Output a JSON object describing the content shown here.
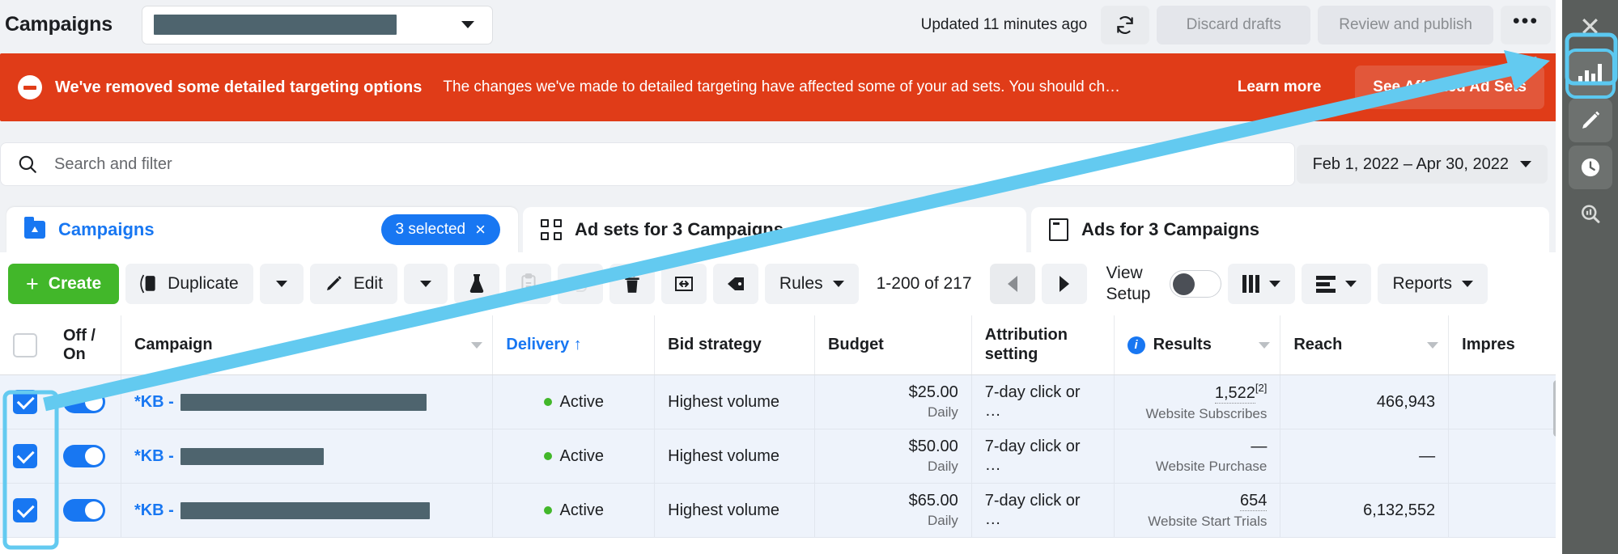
{
  "header": {
    "title": "Campaigns",
    "account_selector": {
      "value_redacted": true,
      "caret": "chevron-down-icon"
    },
    "updated_text": "Updated 11 minutes ago",
    "refresh_icon": "refresh-icon",
    "discard_label": "Discard drafts",
    "review_label": "Review and publish",
    "more_label": "•••"
  },
  "banner": {
    "icon": "minus-circle-icon",
    "title": "We've removed some detailed targeting options",
    "body": "The changes we've made to detailed targeting have affected some of your ad sets. You should ch…",
    "learn_more": "Learn more",
    "cta": "See Affected Ad Sets",
    "color": "#e03c18",
    "cta_color": "#e2573a"
  },
  "search": {
    "placeholder": "Search and filter",
    "icon": "search-icon",
    "date_range": "Feb 1, 2022 – Apr 30, 2022"
  },
  "tabs": [
    {
      "label": "Campaigns",
      "icon": "folder-icon",
      "active": true,
      "badge": "3 selected",
      "badge_close": "×"
    },
    {
      "label": "Ad sets for 3 Campaigns",
      "icon": "grid-icon",
      "active": false
    },
    {
      "label": "Ads for 3 Campaigns",
      "icon": "ads-icon",
      "active": false
    }
  ],
  "toolbar": {
    "create_label": "Create",
    "create_plus": "+",
    "duplicate_label": "Duplicate",
    "edit_label": "Edit",
    "ab_test_icon": "flask-icon",
    "clipboard_icon": "clipboard-icon",
    "undo_icon": "undo-icon",
    "delete_icon": "trash-icon",
    "export_icon": "export-icon",
    "tag_icon": "tag-icon",
    "rules_label": "Rules",
    "pagination": "1-200 of 217",
    "prev_icon": "triangle-left-icon",
    "next_icon": "triangle-right-icon",
    "view_setup_line1": "View",
    "view_setup_line2": "Setup",
    "toggle_state": "off",
    "columns_icon": "columns-icon",
    "breakdown_icon": "breakdown-icon",
    "reports_label": "Reports"
  },
  "table": {
    "columns": [
      {
        "key": "check",
        "label": "",
        "icon": "checkbox-icon"
      },
      {
        "key": "offon",
        "label": "Off / On"
      },
      {
        "key": "campaign",
        "label": "Campaign",
        "sortable": true
      },
      {
        "key": "delivery",
        "label": "Delivery ↑",
        "blue": true
      },
      {
        "key": "bid",
        "label": "Bid strategy"
      },
      {
        "key": "budget",
        "label": "Budget"
      },
      {
        "key": "attr",
        "label": "Attribution setting",
        "line1": "Attribution",
        "line2": "setting"
      },
      {
        "key": "results",
        "label": "Results",
        "info": true,
        "sortable": true
      },
      {
        "key": "reach",
        "label": "Reach",
        "sortable": true
      },
      {
        "key": "impr",
        "label": "Impres"
      }
    ],
    "rows": [
      {
        "checked": true,
        "toggle": "on",
        "campaign_prefix": "*KB -",
        "campaign_redact_width": 304,
        "delivery": "Active",
        "bid_strategy": "Highest volume",
        "budget": "$25.00",
        "budget_sub": "Daily",
        "attribution": "7-day click or …",
        "results_value": "1,522",
        "results_sup": "[2]",
        "results_sub": "Website Subscribes",
        "reach": "466,943"
      },
      {
        "checked": true,
        "toggle": "on",
        "campaign_prefix": "*KB -",
        "campaign_redact_width": 177,
        "delivery": "Active",
        "bid_strategy": "Highest volume",
        "budget": "$50.00",
        "budget_sub": "Daily",
        "attribution": "7-day click or …",
        "results_value": "—",
        "results_sup": "",
        "results_sub": "Website Purchase",
        "reach": "—"
      },
      {
        "checked": true,
        "toggle": "on",
        "campaign_prefix": "*KB -",
        "campaign_redact_width": 308,
        "delivery": "Active",
        "bid_strategy": "Highest volume",
        "budget": "$65.00",
        "budget_sub": "Daily",
        "attribution": "7-day click or …",
        "results_value": "654",
        "results_sup": "",
        "results_sub": "Website Start Trials",
        "reach": "6,132,552"
      }
    ]
  },
  "right_sidebar": {
    "close_icon": "close-icon",
    "items": [
      {
        "icon": "bar-chart-icon",
        "highlighted": true
      },
      {
        "icon": "pencil-icon",
        "highlighted": false
      },
      {
        "icon": "clock-icon",
        "highlighted": false
      },
      {
        "icon": "chart-search-icon",
        "highlighted": false
      }
    ]
  },
  "annotation": {
    "arrow_color": "#63caf0"
  },
  "colors": {
    "accent_blue": "#1877f2",
    "green": "#42b72a",
    "banner_red": "#e03c18",
    "sidebar_gray": "#5a5e5c",
    "row_highlight": "#eef3fb"
  }
}
